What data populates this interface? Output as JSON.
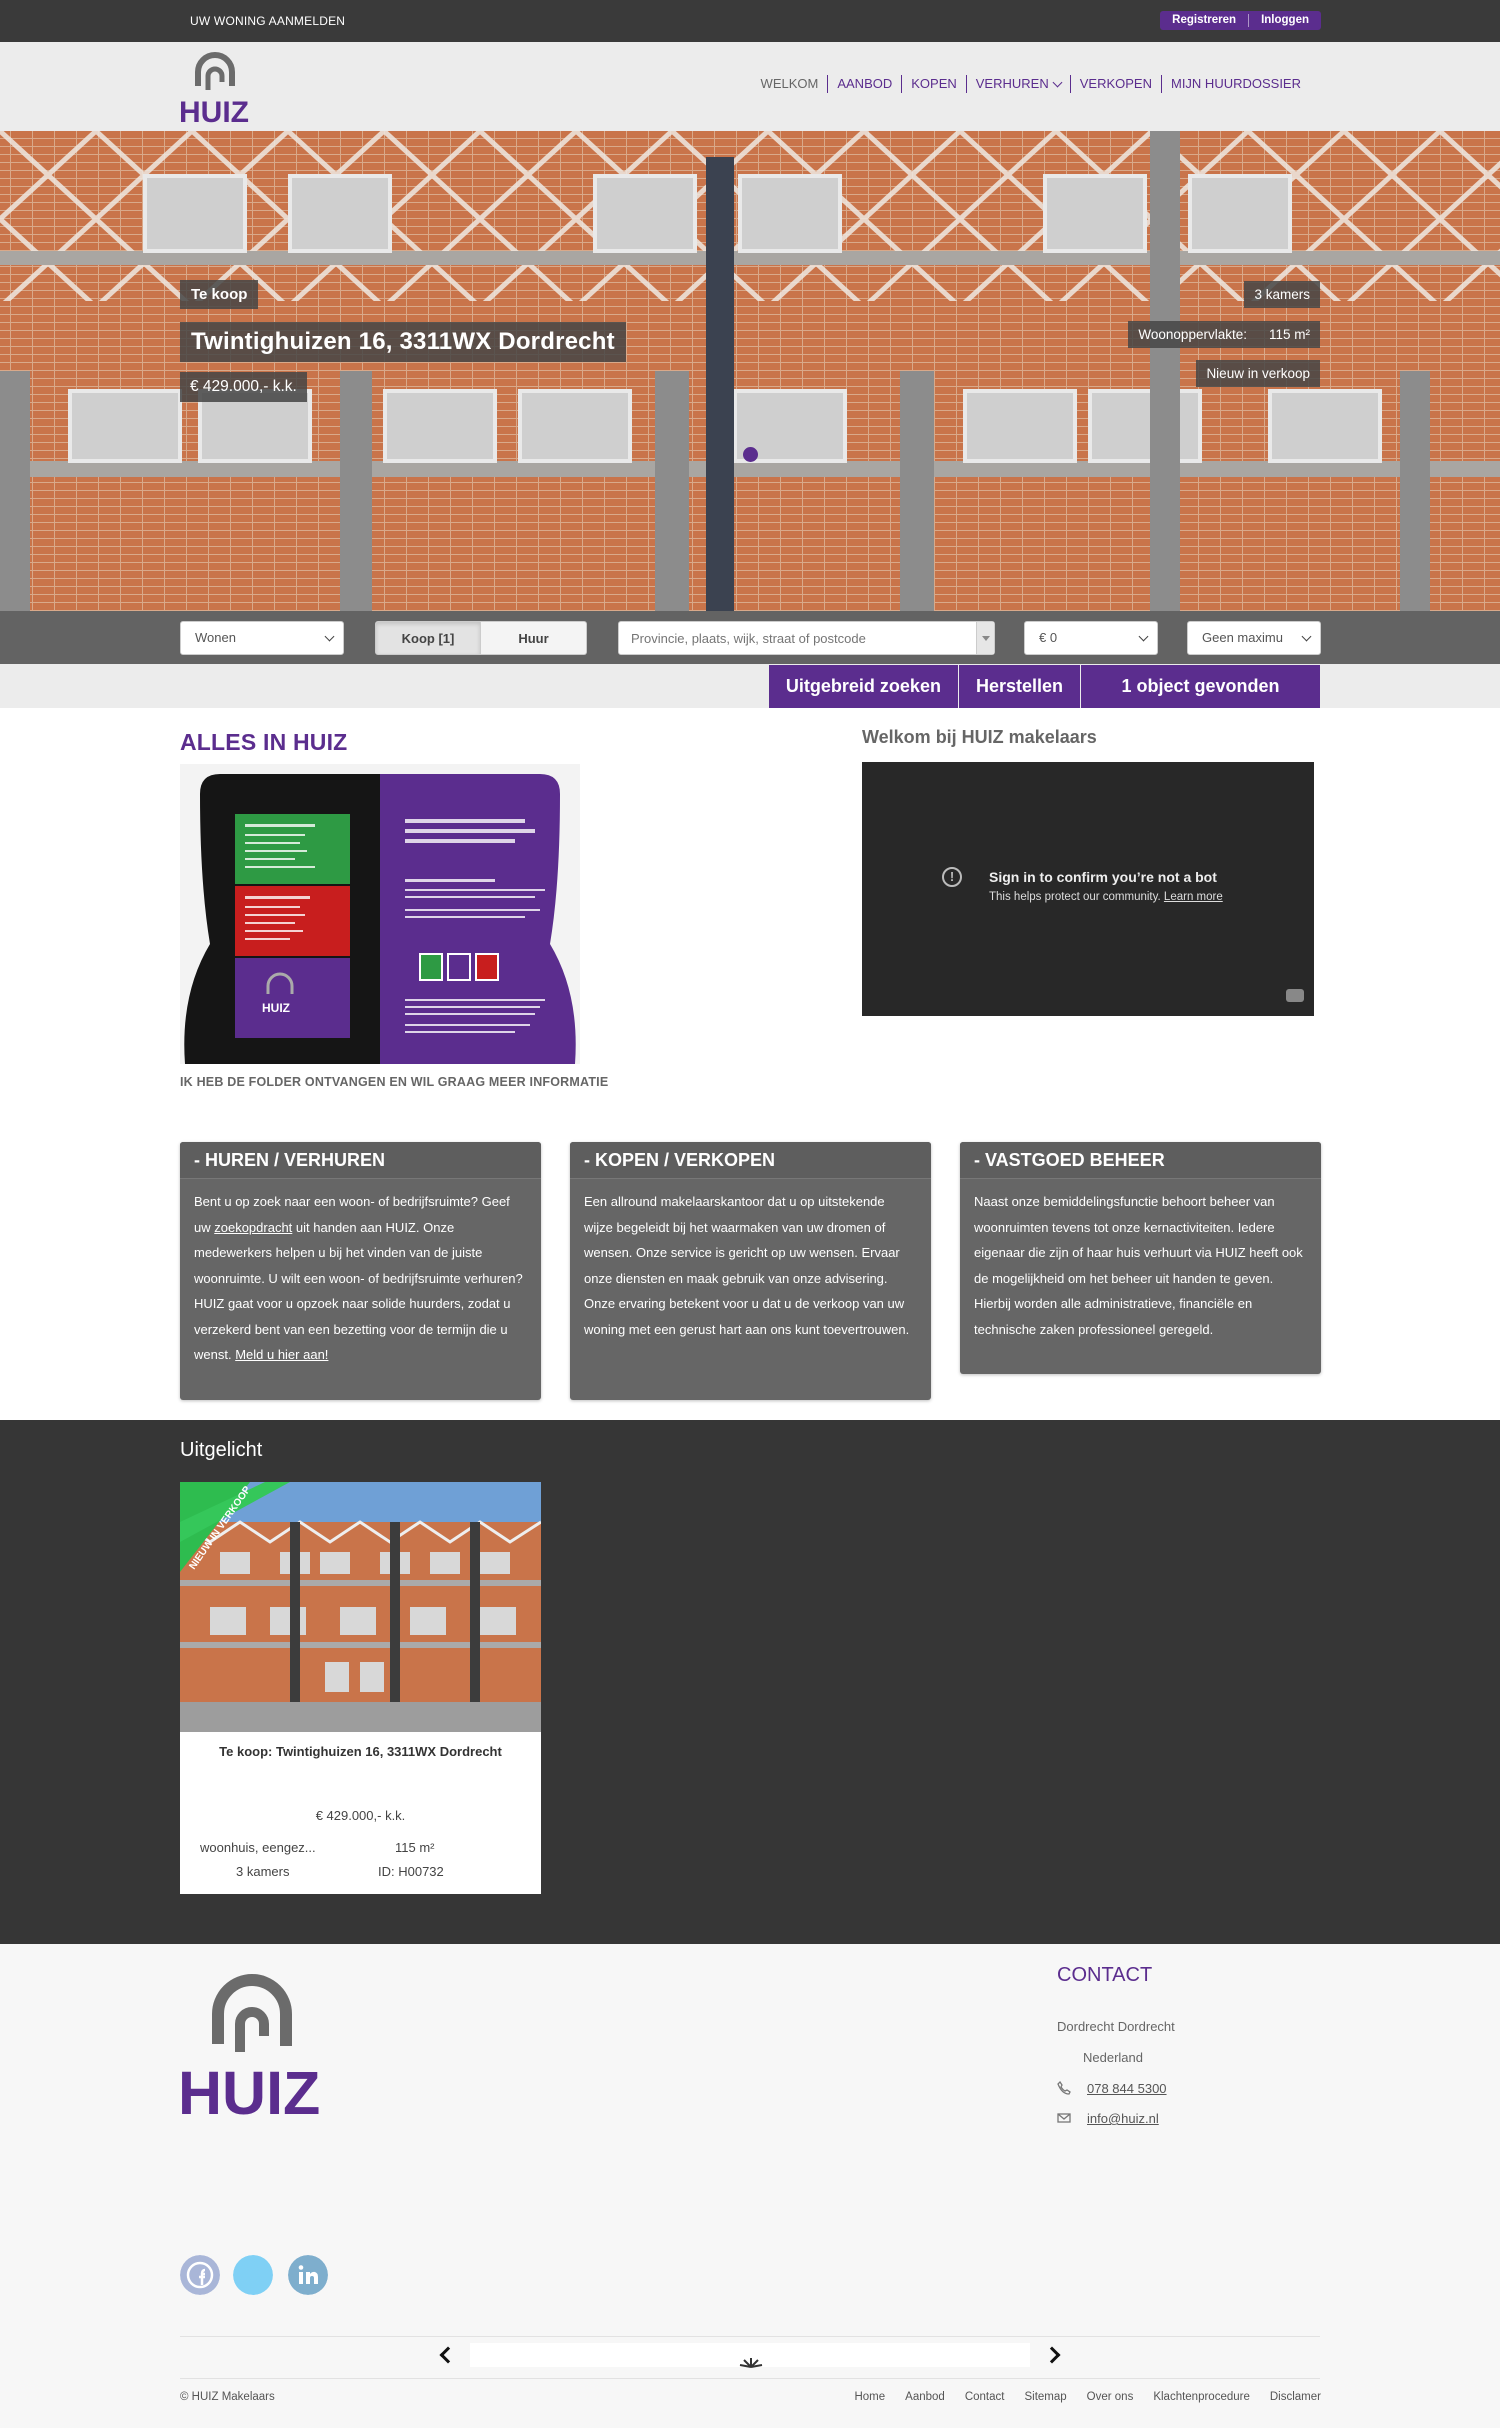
{
  "topbar": {
    "announce": "UW WONING AANMELDEN",
    "register": "Registreren",
    "login": "Inloggen"
  },
  "brand": {
    "name": "HUIZ",
    "color": "#5b2d8e"
  },
  "nav": {
    "items": [
      "WELKOM",
      "AANBOD",
      "KOPEN",
      "VERHUREN",
      "VERKOPEN",
      "MIJN HUURDOSSIER"
    ]
  },
  "hero": {
    "type": "Te koop",
    "address": "Twintighuizen 16, 3311WX Dordrecht",
    "price": "€ 429.000,- k.k.",
    "rooms": "3 kamers",
    "area_label": "Woonoppervlakte:",
    "area_value": "115 m²",
    "status": "Nieuw in verkoop"
  },
  "search": {
    "category": "Wonen",
    "buy_label": "Koop [1]",
    "rent_label": "Huur",
    "location_placeholder": "Provincie, plaats, wijk, straat of postcode",
    "min_price": "€ 0",
    "max_price": "Geen maximu",
    "advanced": "Uitgebreid zoeken",
    "reset": "Herstellen",
    "results": "1 object gevonden"
  },
  "intro": {
    "heading": "ALLES IN HUIZ",
    "folder_link": "IK HEB DE FOLDER ONTVANGEN EN WIL GRAAG MEER INFORMATIE",
    "video_heading": "Welkom bij HUIZ makelaars",
    "video_msg": "Sign in to confirm you’re not a bot",
    "video_sub": "This helps protect our community.",
    "video_learn": "Learn more"
  },
  "cards": [
    {
      "title": "- HUREN / VERHUREN",
      "t1": "Bent u op zoek naar een woon- of bedrijfsruimte? Geef uw ",
      "link1": "zoekopdracht",
      "t2": " uit handen aan HUIZ. Onze medewerkers helpen u bij het vinden van de juiste woonruimte. U wilt een woon- of bedrijfsruimte verhuren? HUIZ gaat voor u opzoek naar solide huurders, zodat u verzekerd bent van een bezetting voor de termijn die u wenst. ",
      "link2": "Meld u hier aan!"
    },
    {
      "title": "- KOPEN / VERKOPEN",
      "text": "Een allround makelaarskantoor dat u op uitstekende wijze begeleidt bij het waarmaken van uw dromen of wensen. Onze service is gericht op uw wensen. Ervaar onze diensten en maak gebruik van onze advisering. Onze ervaring betekent voor u dat u de verkoop van uw woning met een gerust hart aan ons kunt toevertrouwen."
    },
    {
      "title": "- VASTGOED BEHEER",
      "text": "Naast onze bemiddelingsfunctie behoort beheer van woonruimten tevens tot onze kernactiviteiten. Iedere eigenaar die zijn of haar huis verhuurt via HUIZ heeft ook de mogelijkheid om het beheer uit handen te geven. Hierbij worden alle administratieve, financiële en technische zaken professioneel geregeld."
    }
  ],
  "featured": {
    "heading": "Uitgelicht",
    "ribbon": "NIEUW IN VERKOOP",
    "title": "Te koop: Twintighuizen 16, 3311WX Dordrecht",
    "price": "€ 429.000,- k.k.",
    "kind": "woonhuis, eengez...",
    "area": "115 m²",
    "rooms": "3 kamers",
    "id": "ID: H00732"
  },
  "footer": {
    "contact_heading": "CONTACT",
    "city": "Dordrecht Dordrecht",
    "country": "Nederland",
    "phone": "078 844 5300",
    "email": "info@huiz.nl",
    "copyright": "© HUIZ Makelaars",
    "links": [
      "Home",
      "Aanbod",
      "Contact",
      "Sitemap",
      "Over ons",
      "Klachtenprocedure",
      "Disclamer"
    ]
  }
}
